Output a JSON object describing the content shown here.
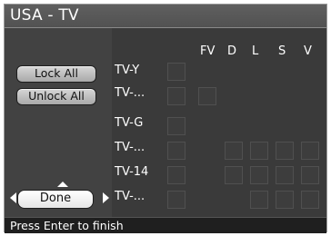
{
  "window": {
    "title": "USA - TV"
  },
  "buttons": {
    "lock_all": "Lock All",
    "unlock_all": "Unlock All",
    "done": "Done"
  },
  "columns": [
    "FV",
    "D",
    "L",
    "S",
    "V"
  ],
  "rows": [
    {
      "label": "TV-Y"
    },
    {
      "label": "TV-..."
    },
    {
      "label": "TV-G"
    },
    {
      "label": "TV-..."
    },
    {
      "label": "TV-14"
    },
    {
      "label": "TV-..."
    }
  ],
  "status": {
    "text": "Press Enter to finish"
  }
}
